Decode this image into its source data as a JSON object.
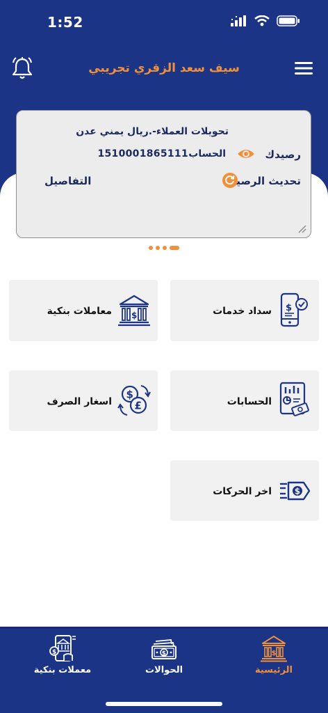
{
  "status_bar": {
    "time": "1:52"
  },
  "header": {
    "title": "سيف سعد الزقري تجريبي"
  },
  "balance_card": {
    "title": "تحويلات العملاء-.ريال يمني عدن",
    "balance_label": "رصيدك",
    "account_label": "الحساب",
    "account_number": "1510001865111",
    "refresh_label": "تحديث الرصيد",
    "details_label": "التفاصيل"
  },
  "pager": {
    "count": 4,
    "active_index": 3
  },
  "services": [
    {
      "id": "bill-payment",
      "label": "سداد خدمات",
      "icon": "phone-bill-icon"
    },
    {
      "id": "bank-transactions",
      "label": "معاملات بنكية",
      "icon": "bank-icon"
    },
    {
      "id": "accounts",
      "label": "الحسابات",
      "icon": "accounts-chart-icon"
    },
    {
      "id": "exchange-rates",
      "label": "اسغار الصرف",
      "icon": "currency-exchange-icon"
    },
    {
      "id": "last-movements",
      "label": "اخر الحركات",
      "icon": "money-transfer-icon"
    }
  ],
  "bottom_nav": [
    {
      "label": "الرئيسية",
      "icon": "home-bank-icon",
      "active": true
    },
    {
      "label": "الحوالات",
      "icon": "banknote-icon",
      "active": false
    },
    {
      "label": "معملات بنكية",
      "icon": "mobile-banking-icon",
      "active": false
    }
  ],
  "colors": {
    "primary": "#1b3486",
    "accent": "#f0913a",
    "card": "#ececec",
    "tile": "#f1f1f1"
  }
}
